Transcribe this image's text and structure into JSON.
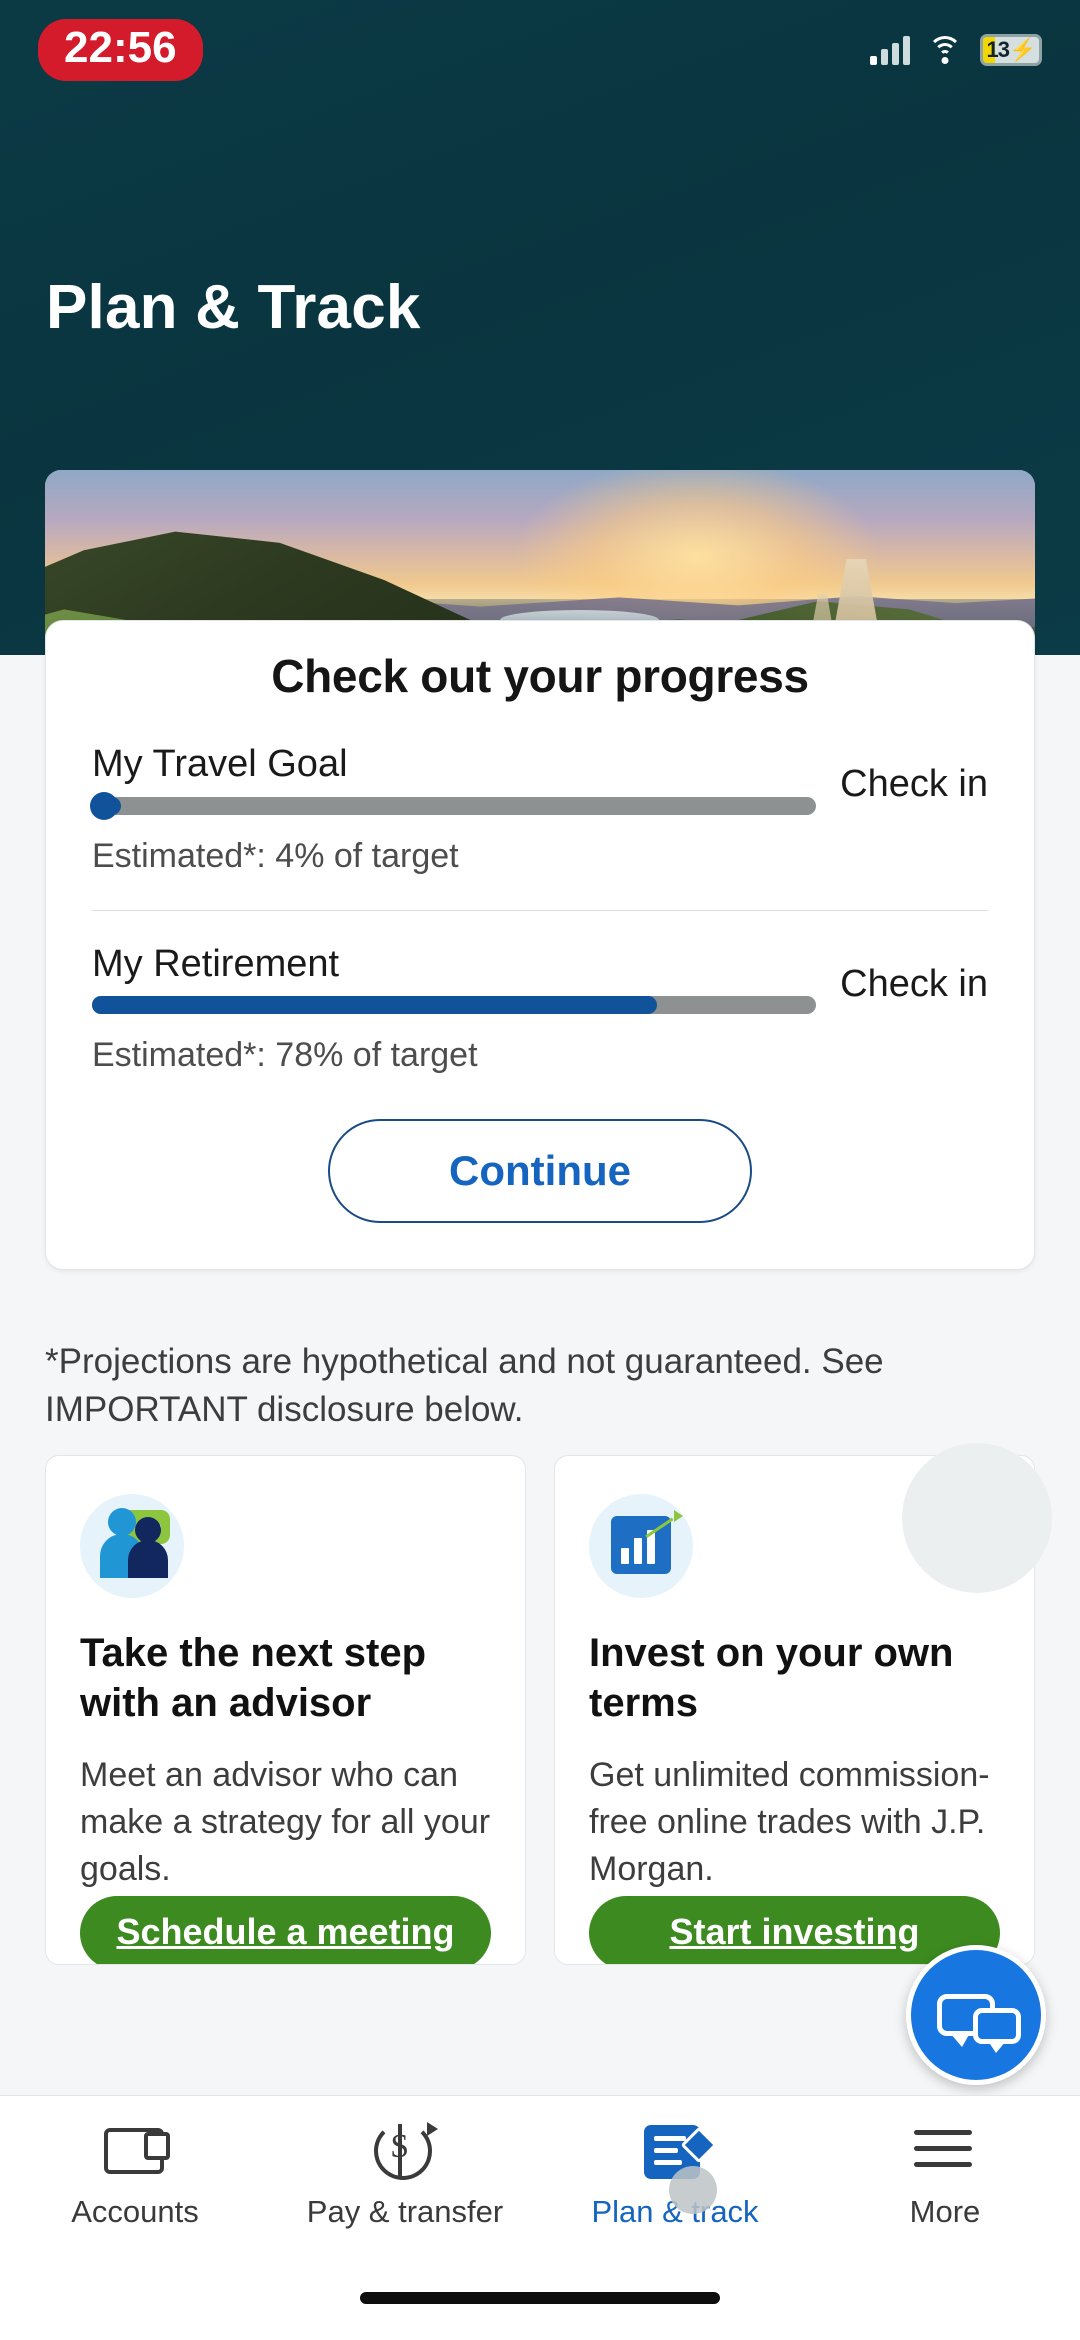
{
  "status_bar": {
    "time": "22:56",
    "battery_percent": "13",
    "battery_charging": true,
    "signal_icon": "signal-bars-icon",
    "wifi_icon": "wifi-icon",
    "battery_icon": "battery-icon"
  },
  "header": {
    "title": "Plan & Track",
    "background_color": "#0b3a45"
  },
  "hero": {
    "image_alt": "mountain-sunset-landscape"
  },
  "progress_card": {
    "title": "Check out your progress",
    "goals": [
      {
        "name": "My Travel Goal",
        "action_label": "Check in",
        "progress_percent": 4,
        "subtitle": "Estimated*: 4% of target"
      },
      {
        "name": "My Retirement",
        "action_label": "Check in",
        "progress_percent": 78,
        "subtitle": "Estimated*: 78% of target"
      }
    ],
    "continue_label": "Continue",
    "accent_color": "#10539b"
  },
  "disclaimer": "*Projections are hypothetical and not guaranteed. See IMPORTANT disclosure below.",
  "promos": [
    {
      "icon": "advisor-people-chat-icon",
      "title": "Take the next step with an advisor",
      "body": "Meet an advisor who can make a strategy for all your goals.",
      "cta_label": "Schedule a meeting",
      "cta_color": "#3d8b20"
    },
    {
      "icon": "investment-chart-icon",
      "title": "Invest on your own terms",
      "body": "Get unlimited commission-free online trades with J.P. Morgan.",
      "cta_label": "Start investing",
      "cta_color": "#3d8b20"
    }
  ],
  "chat_fab": {
    "icon": "chat-bubbles-icon",
    "color": "#1776e0"
  },
  "bottom_nav": {
    "active_color": "#1565c0",
    "items": [
      {
        "label": "Accounts",
        "icon": "wallet-icon",
        "active": false
      },
      {
        "label": "Pay & transfer",
        "icon": "dollar-transfer-icon",
        "active": false
      },
      {
        "label": "Plan & track",
        "icon": "plan-track-icon",
        "active": true
      },
      {
        "label": "More",
        "icon": "hamburger-menu-icon",
        "active": false
      }
    ]
  }
}
